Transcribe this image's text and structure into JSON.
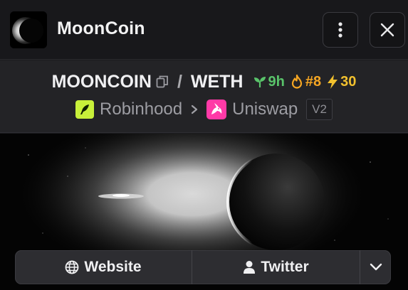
{
  "header": {
    "title": "MoonCoin",
    "logo_icon": "eclipse-logo",
    "menu_icon": "kebab-menu-icon",
    "close_icon": "close-icon"
  },
  "pair": {
    "base": "MOONCOIN",
    "separator": "/",
    "quote": "WETH",
    "age": "9h",
    "rank": "#8",
    "boosts": "30",
    "colors": {
      "age": "#59c36a",
      "rank": "#f5a623",
      "boosts": "#f2c12e"
    }
  },
  "source": {
    "chain": "Robinhood",
    "dex": "Uniswap",
    "version": "V2",
    "colors": {
      "chain_badge": "#c8f03a",
      "dex_badge": "#ff3aa7"
    }
  },
  "links": {
    "website": "Website",
    "twitter": "Twitter",
    "website_icon": "globe-icon",
    "twitter_icon": "user-icon",
    "more_icon": "chevron-down-icon"
  }
}
